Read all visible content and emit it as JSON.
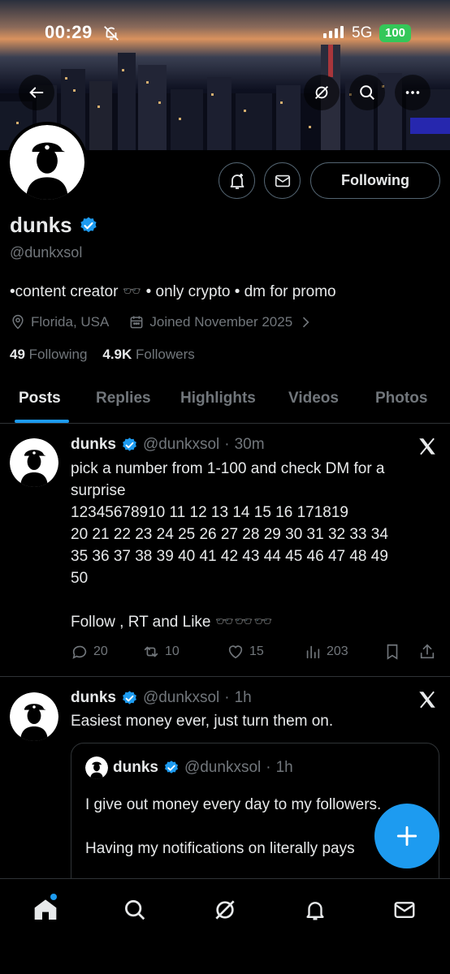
{
  "status_bar": {
    "time": "00:29",
    "network": "5G",
    "battery": "100"
  },
  "profile": {
    "display_name": "dunks",
    "handle": "@dunkxsol",
    "bio": "•content creator 🕶️ • only crypto • dm for promo",
    "location": "Florida, USA",
    "joined": "Joined November 2025",
    "following_count": "49",
    "following_label": "Following",
    "followers_count": "4.9K",
    "followers_label": "Followers",
    "follow_button_label": "Following"
  },
  "tabs": [
    {
      "label": "Posts",
      "active": true
    },
    {
      "label": "Replies",
      "active": false
    },
    {
      "label": "Highlights",
      "active": false
    },
    {
      "label": "Videos",
      "active": false
    },
    {
      "label": "Photos",
      "active": false
    }
  ],
  "posts": [
    {
      "name": "dunks",
      "handle": "@dunkxsol",
      "time": "30m",
      "text": "pick a number from 1-100 and check DM for a surprise\n12345678910 11 12 13 14 15 16 171819\n20 21 22 23 24 25 26 27 28 29 30 31 32 33 34\n35 36 37 38 39 40 41 42 43 44 45 46 47 48 49\n50\n\nFollow , RT and Like 🕶️🕶️🕶️",
      "replies": "20",
      "reposts": "10",
      "likes": "15",
      "views": "203"
    },
    {
      "name": "dunks",
      "handle": "@dunkxsol",
      "time": "1h",
      "text": "Easiest money ever, just turn them on.",
      "quote": {
        "name": "dunks",
        "handle": "@dunkxsol",
        "time": "1h",
        "text": "I give out money every day to my followers.\n\nHaving my notifications on literally pays"
      }
    }
  ],
  "icons": {
    "back": "arrow-left-icon",
    "grok": "grok-icon",
    "search": "search-icon",
    "more": "more-icon",
    "notify": "bell-plus-icon",
    "message": "mail-icon",
    "x_logo": "x-logo-icon",
    "compose": "plus-icon"
  },
  "colors": {
    "accent": "#1d9bf0",
    "battery": "#34c759",
    "muted": "#71767b"
  }
}
